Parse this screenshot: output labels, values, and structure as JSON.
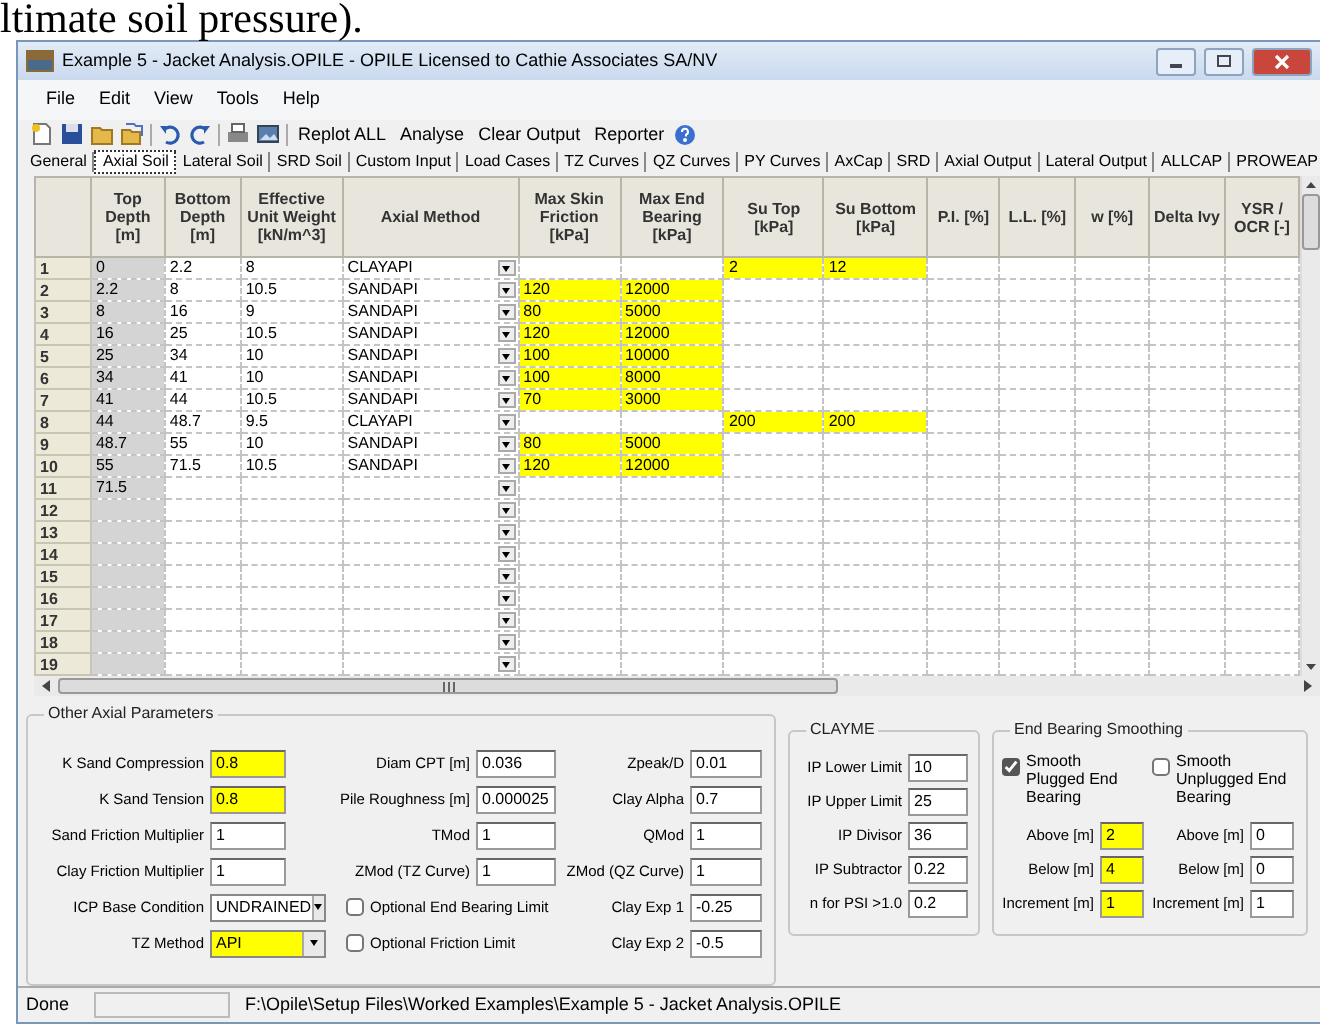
{
  "document_text": "ltimate soil pressure).",
  "window": {
    "title": "Example 5 - Jacket Analysis.OPILE - OPILE Licensed to Cathie Associates SA/NV"
  },
  "menu": [
    "File",
    "Edit",
    "View",
    "Tools",
    "Help"
  ],
  "toolbar_buttons": [
    "Replot ALL",
    "Analyse",
    "Clear Output",
    "Reporter"
  ],
  "tabs": [
    {
      "label": "General",
      "selected": false
    },
    {
      "label": "Axial Soil",
      "selected": true
    },
    {
      "label": "Lateral Soil",
      "selected": false
    },
    {
      "label": "SRD Soil",
      "selected": false
    },
    {
      "label": "Custom Input",
      "selected": false
    },
    {
      "label": "Load Cases",
      "selected": false
    },
    {
      "label": "TZ Curves",
      "selected": false
    },
    {
      "label": "QZ Curves",
      "selected": false
    },
    {
      "label": "PY Curves",
      "selected": false
    },
    {
      "label": "AxCap",
      "selected": false
    },
    {
      "label": "SRD",
      "selected": false
    },
    {
      "label": "Axial Output",
      "selected": false
    },
    {
      "label": "Lateral Output",
      "selected": false
    },
    {
      "label": "ALLCAP",
      "selected": false
    },
    {
      "label": "PROWEAP",
      "selected": false
    }
  ],
  "grid": {
    "columns": [
      {
        "header": "Top Depth [m]",
        "kind": "text",
        "readonly": true
      },
      {
        "header": "Bottom Depth [m]",
        "kind": "text",
        "readonly": false
      },
      {
        "header": "Effective Unit Weight [kN/m^3]",
        "kind": "text",
        "readonly": false
      },
      {
        "header": "Axial Method",
        "kind": "dropdown",
        "readonly": false
      },
      {
        "header": "Max Skin Friction [kPa]",
        "kind": "text",
        "readonly": false
      },
      {
        "header": "Max End Bearing [kPa]",
        "kind": "text",
        "readonly": false
      },
      {
        "header": "Su Top [kPa]",
        "kind": "text",
        "readonly": false
      },
      {
        "header": "Su Bottom [kPa]",
        "kind": "text",
        "readonly": false
      },
      {
        "header": "P.I. [%]",
        "kind": "text",
        "readonly": false
      },
      {
        "header": "L.L. [%]",
        "kind": "text",
        "readonly": false
      },
      {
        "header": "w [%]",
        "kind": "text",
        "readonly": false
      },
      {
        "header": "Delta Ivy",
        "kind": "text",
        "readonly": false
      },
      {
        "header": "YSR / OCR [-]",
        "kind": "text",
        "readonly": false
      }
    ],
    "rows": [
      {
        "number": "1",
        "cells": [
          {
            "text": "0",
            "highlighted": false
          },
          {
            "text": "2.2",
            "highlighted": false
          },
          {
            "text": "8",
            "highlighted": false
          },
          {
            "text": "CLAYAPI",
            "highlighted": false
          },
          null,
          null,
          {
            "text": "2",
            "highlighted": true
          },
          {
            "text": "12",
            "highlighted": true
          }
        ]
      },
      {
        "number": "2",
        "cells": [
          {
            "text": "2.2",
            "highlighted": false
          },
          {
            "text": "8",
            "highlighted": false
          },
          {
            "text": "10.5",
            "highlighted": false
          },
          {
            "text": "SANDAPI",
            "highlighted": false
          },
          {
            "text": "120",
            "highlighted": true
          },
          {
            "text": "12000",
            "highlighted": true
          }
        ]
      },
      {
        "number": "3",
        "cells": [
          {
            "text": "8",
            "highlighted": false
          },
          {
            "text": "16",
            "highlighted": false
          },
          {
            "text": "9",
            "highlighted": false
          },
          {
            "text": "SANDAPI",
            "highlighted": false
          },
          {
            "text": "80",
            "highlighted": true
          },
          {
            "text": "5000",
            "highlighted": true
          }
        ]
      },
      {
        "number": "4",
        "cells": [
          {
            "text": "16",
            "highlighted": false
          },
          {
            "text": "25",
            "highlighted": false
          },
          {
            "text": "10.5",
            "highlighted": false
          },
          {
            "text": "SANDAPI",
            "highlighted": false
          },
          {
            "text": "120",
            "highlighted": true
          },
          {
            "text": "12000",
            "highlighted": true
          }
        ]
      },
      {
        "number": "5",
        "cells": [
          {
            "text": "25",
            "highlighted": false
          },
          {
            "text": "34",
            "highlighted": false
          },
          {
            "text": "10",
            "highlighted": false
          },
          {
            "text": "SANDAPI",
            "highlighted": false
          },
          {
            "text": "100",
            "highlighted": true
          },
          {
            "text": "10000",
            "highlighted": true
          }
        ]
      },
      {
        "number": "6",
        "cells": [
          {
            "text": "34",
            "highlighted": false
          },
          {
            "text": "41",
            "highlighted": false
          },
          {
            "text": "10",
            "highlighted": false
          },
          {
            "text": "SANDAPI",
            "highlighted": false
          },
          {
            "text": "100",
            "highlighted": true
          },
          {
            "text": "8000",
            "highlighted": true
          }
        ]
      },
      {
        "number": "7",
        "cells": [
          {
            "text": "41",
            "highlighted": false
          },
          {
            "text": "44",
            "highlighted": false
          },
          {
            "text": "10.5",
            "highlighted": false
          },
          {
            "text": "SANDAPI",
            "highlighted": false
          },
          {
            "text": "70",
            "highlighted": true
          },
          {
            "text": "3000",
            "highlighted": true
          }
        ]
      },
      {
        "number": "8",
        "cells": [
          {
            "text": "44",
            "highlighted": false
          },
          {
            "text": "48.7",
            "highlighted": false
          },
          {
            "text": "9.5",
            "highlighted": false
          },
          {
            "text": "CLAYAPI",
            "highlighted": false
          },
          null,
          null,
          {
            "text": "200",
            "highlighted": true
          },
          {
            "text": "200",
            "highlighted": true
          }
        ]
      },
      {
        "number": "9",
        "cells": [
          {
            "text": "48.7",
            "highlighted": false
          },
          {
            "text": "55",
            "highlighted": false
          },
          {
            "text": "10",
            "highlighted": false
          },
          {
            "text": "SANDAPI",
            "highlighted": false
          },
          {
            "text": "80",
            "highlighted": true
          },
          {
            "text": "5000",
            "highlighted": true
          }
        ]
      },
      {
        "number": "10",
        "cells": [
          {
            "text": "55",
            "highlighted": false
          },
          {
            "text": "71.5",
            "highlighted": false
          },
          {
            "text": "10.5",
            "highlighted": false
          },
          {
            "text": "SANDAPI",
            "highlighted": false
          },
          {
            "text": "120",
            "highlighted": true
          },
          {
            "text": "12000",
            "highlighted": true
          }
        ]
      },
      {
        "number": "11",
        "cells": [
          {
            "text": "71.5",
            "highlighted": false
          }
        ]
      },
      {
        "number": "12"
      },
      {
        "number": "13"
      },
      {
        "number": "14"
      },
      {
        "number": "15"
      },
      {
        "number": "16"
      },
      {
        "number": "17"
      },
      {
        "number": "18"
      },
      {
        "number": "19"
      }
    ]
  },
  "other_axial_parameters": {
    "title": "Other Axial Parameters",
    "columns": [
      [
        {
          "kind": "field",
          "label": "K Sand Compression",
          "value": "0.8",
          "highlighted": true
        },
        {
          "kind": "field",
          "label": "K Sand Tension",
          "value": "0.8",
          "highlighted": true
        },
        {
          "kind": "field",
          "label": "Sand Friction Multiplier",
          "value": "1",
          "highlighted": false
        },
        {
          "kind": "field",
          "label": "Clay Friction Multiplier",
          "value": "1",
          "highlighted": false
        },
        {
          "kind": "dropdown",
          "label": "ICP Base Condition",
          "value": "UNDRAINED",
          "highlighted": false
        },
        {
          "kind": "dropdown",
          "label": "TZ Method",
          "value": "API",
          "highlighted": true
        }
      ],
      [
        {
          "kind": "field",
          "label": "Diam CPT [m]",
          "value": "0.036",
          "highlighted": false
        },
        {
          "kind": "field",
          "label": "Pile Roughness [m]",
          "value": "0.000025",
          "highlighted": false
        },
        {
          "kind": "field",
          "label": "TMod",
          "value": "1",
          "highlighted": false
        },
        {
          "kind": "field",
          "label": "ZMod (TZ Curve)",
          "value": "1",
          "highlighted": false
        },
        {
          "kind": "checkbox",
          "label": "Optional End Bearing Limit",
          "checked": false
        },
        {
          "kind": "checkbox",
          "label": "Optional Friction Limit",
          "checked": false
        }
      ],
      [
        {
          "kind": "field",
          "label": "Zpeak/D",
          "value": "0.01",
          "highlighted": false
        },
        {
          "kind": "field",
          "label": "Clay Alpha",
          "value": "0.7",
          "highlighted": false
        },
        {
          "kind": "field",
          "label": "QMod",
          "value": "1",
          "highlighted": false
        },
        {
          "kind": "field",
          "label": "ZMod (QZ Curve)",
          "value": "1",
          "highlighted": false
        },
        {
          "kind": "field",
          "label": "Clay Exp 1",
          "value": "-0.25",
          "highlighted": false
        },
        {
          "kind": "field",
          "label": "Clay Exp 2",
          "value": "-0.5",
          "highlighted": false
        }
      ]
    ]
  },
  "clayme": {
    "title": "CLAYME",
    "fields": [
      {
        "label": "IP Lower Limit",
        "value": "10"
      },
      {
        "label": "IP Upper Limit",
        "value": "25"
      },
      {
        "label": "IP Divisor",
        "value": "36"
      },
      {
        "label": "IP Subtractor",
        "value": "0.22"
      },
      {
        "label": "n for PSI >1.0",
        "value": "0.2"
      }
    ]
  },
  "end_bearing_smoothing": {
    "title": "End Bearing Smoothing",
    "columns": [
      {
        "checkbox": {
          "label": "Smooth Plugged End Bearing",
          "checked": true
        },
        "fields": [
          {
            "label": "Above [m]",
            "value": "2",
            "highlighted": true
          },
          {
            "label": "Below [m]",
            "value": "4",
            "highlighted": true
          },
          {
            "label": "Increment [m]",
            "value": "1",
            "highlighted": true
          }
        ]
      },
      {
        "checkbox": {
          "label": "Smooth Unplugged End Bearing",
          "checked": false
        },
        "fields": [
          {
            "label": "Above [m]",
            "value": "0",
            "highlighted": false
          },
          {
            "label": "Below [m]",
            "value": "0",
            "highlighted": false
          },
          {
            "label": "Increment [m]",
            "value": "1",
            "highlighted": false
          }
        ]
      }
    ]
  },
  "status_bar": {
    "message": "Done",
    "path": "F:\\Opile\\Setup Files\\Worked Examples\\Example 5 - Jacket Analysis.OPILE"
  }
}
